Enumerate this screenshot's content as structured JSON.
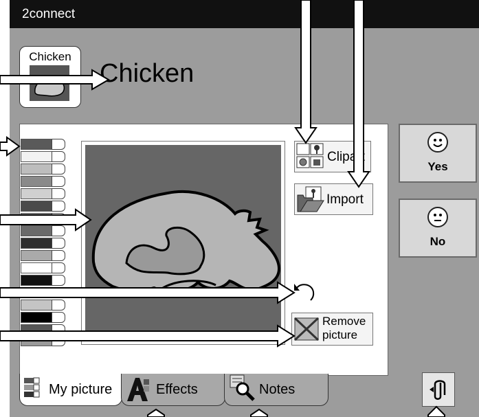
{
  "app": {
    "title": "2connect"
  },
  "card": {
    "label": "Chicken"
  },
  "page": {
    "heading": "Chicken"
  },
  "tools": {
    "clipart_label": "Clipart",
    "import_label": "Import",
    "remove_label_line1": "Remove",
    "remove_label_line2": "picture"
  },
  "response": {
    "yes_label": "Yes",
    "no_label": "No"
  },
  "tabs": [
    {
      "label": "My picture",
      "icon": "palette-icon"
    },
    {
      "label": "Effects",
      "icon": "effects-icon"
    },
    {
      "label": "Notes",
      "icon": "notes-icon"
    }
  ],
  "icons": {
    "clipart": "clipart-icon",
    "import": "folder-icon",
    "undo": "undo-icon",
    "remove": "remove-picture-icon",
    "attach": "paperclip-icon",
    "smile": "smiley-icon"
  },
  "colors": {
    "window": "#9c9c9c",
    "titlebar": "#111111",
    "canvas": "#666666",
    "chicken_fill": "#b5b5b5"
  }
}
